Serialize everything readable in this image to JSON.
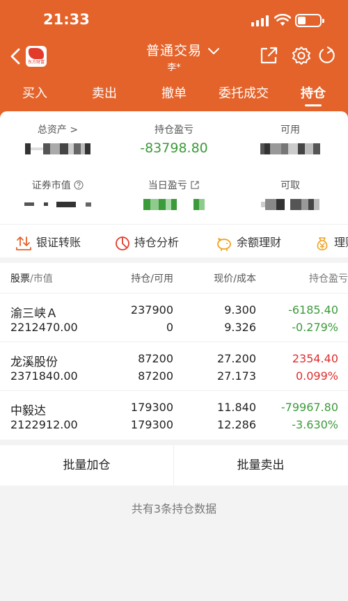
{
  "status": {
    "time": "21:33"
  },
  "nav": {
    "logo_text": "东方财富",
    "title": "普通交易",
    "subtitle": "李*"
  },
  "tabs": [
    {
      "label": "买入"
    },
    {
      "label": "卖出"
    },
    {
      "label": "撤单"
    },
    {
      "label": "委托成交"
    },
    {
      "label": "持仓",
      "active": true
    }
  ],
  "summary": {
    "total_assets_label": "总资产 >",
    "position_pnl_label": "持仓盈亏",
    "position_pnl_value": "-83798.80",
    "available_label": "可用",
    "securities_value_label": "证券市值",
    "daily_pnl_label": "当日盈亏",
    "withdrawable_label": "可取"
  },
  "tools": [
    {
      "label": "银证转账",
      "icon": "transfer-icon"
    },
    {
      "label": "持仓分析",
      "icon": "pie-chart-icon"
    },
    {
      "label": "余额理财",
      "icon": "piggy-bank-icon"
    },
    {
      "label": "理财",
      "icon": "money-bag-icon"
    }
  ],
  "holdings": {
    "headers": {
      "stock": "股票",
      "market_value": "/市值",
      "position": "持仓/可用",
      "price": "现价/成本",
      "pnl": "持仓盈亏"
    },
    "rows": [
      {
        "name": "渝三峡Ａ",
        "market_value": "2212470.00",
        "position": "237900",
        "available": "0",
        "price": "9.300",
        "cost": "9.326",
        "pnl": "-6185.40",
        "pnl_pct": "-0.279%"
      },
      {
        "name": "龙溪股份",
        "market_value": "2371840.00",
        "position": "87200",
        "available": "87200",
        "price": "27.200",
        "cost": "27.173",
        "pnl": "2354.40",
        "pnl_pct": "0.099%"
      },
      {
        "name": "中毅达",
        "market_value": "2122912.00",
        "position": "179300",
        "available": "179300",
        "price": "11.840",
        "cost": "12.286",
        "pnl": "-79967.80",
        "pnl_pct": "-3.630%"
      }
    ]
  },
  "actions": {
    "batch_add": "批量加仓",
    "batch_sell": "批量卖出"
  },
  "footer": "共有3条持仓数据",
  "colors": {
    "brand": "#e4632b",
    "profit": "#e02d2d",
    "loss": "#3b9a3a",
    "tool_icon": "#e4632b"
  }
}
